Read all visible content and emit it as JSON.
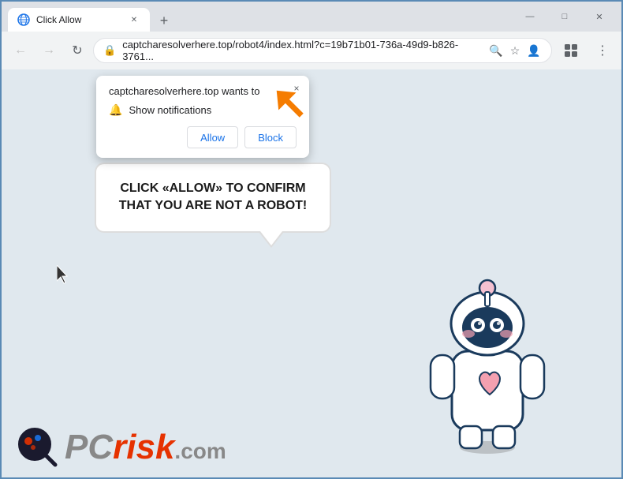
{
  "browser": {
    "tab_title": "Click Allow",
    "url": "captcharesolverhere.top/robot4/index.html?c=19b71b01-736a-49d9-b826-3761...",
    "new_tab_icon": "+",
    "nav": {
      "back_label": "←",
      "forward_label": "→",
      "reload_label": "↻"
    },
    "window_controls": {
      "minimize": "—",
      "maximize": "□",
      "close": "✕"
    }
  },
  "notification_popup": {
    "header": "captcharesolverhere.top wants to",
    "close_label": "×",
    "notification_item": "Show notifications",
    "allow_label": "Allow",
    "block_label": "Block"
  },
  "page": {
    "bubble_text": "CLICK «ALLOW» TO CONFIRM THAT YOU ARE NOT A ROBOT!",
    "logo_text": "PC",
    "logo_risk": "risk",
    "logo_com": ".com"
  },
  "colors": {
    "orange_arrow": "#f57c00",
    "allow_btn_text": "#1a73e8",
    "block_btn_text": "#1a73e8",
    "bubble_text": "#1a1a1a"
  }
}
